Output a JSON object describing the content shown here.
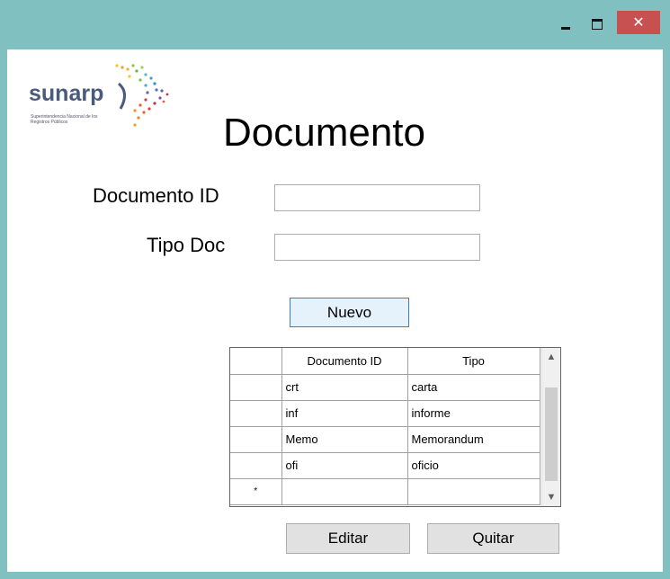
{
  "window": {
    "minimize_glyph": "",
    "close_glyph": "✕"
  },
  "logo": {
    "text": "sunarp",
    "subtitle": "Superintendencia Nacional de los Registros Públicos"
  },
  "form": {
    "title": "Documento",
    "documento_id_label": "Documento ID",
    "documento_id_value": "",
    "tipo_doc_label": "Tipo Doc",
    "tipo_doc_value": "",
    "nuevo_label": "Nuevo",
    "editar_label": "Editar",
    "quitar_label": "Quitar"
  },
  "grid": {
    "columns": [
      "Documento ID",
      "Tipo"
    ],
    "rows": [
      [
        "crt",
        "carta"
      ],
      [
        "inf",
        "informe"
      ],
      [
        "Memo",
        "Memorandum"
      ],
      [
        "ofi",
        "oficio"
      ]
    ],
    "new_row_marker": "*",
    "scroll_up_glyph": "▲",
    "scroll_down_glyph": "▼"
  }
}
